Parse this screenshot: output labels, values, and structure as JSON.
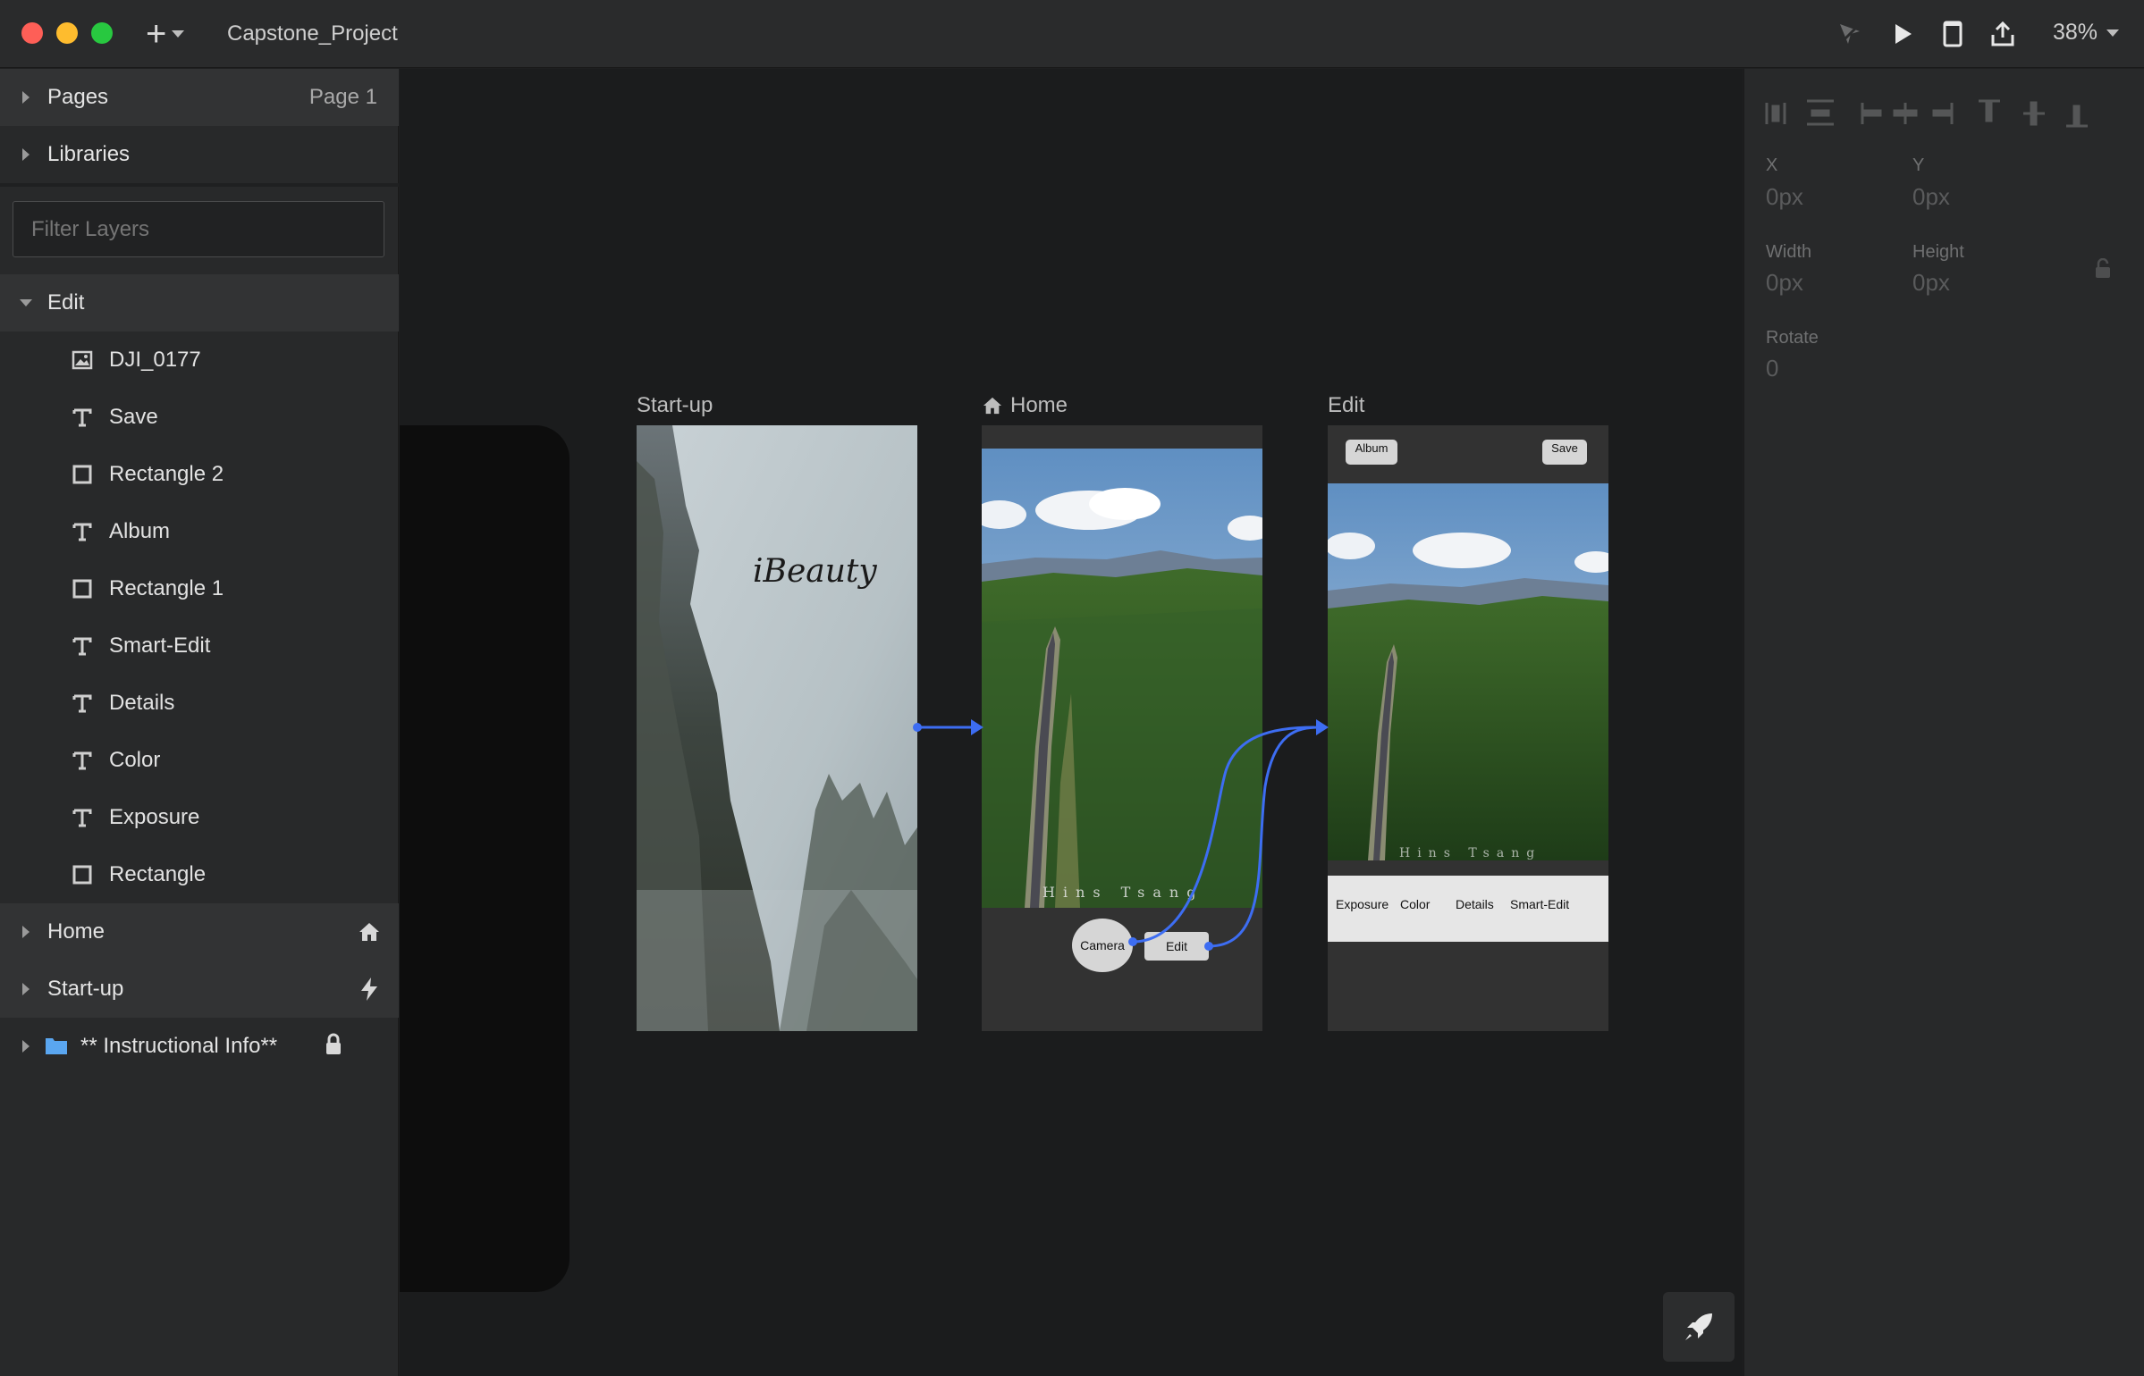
{
  "window": {
    "title": "Capstone_Project",
    "zoom": "38%"
  },
  "left_panel": {
    "pages_label": "Pages",
    "pages_current": "Page 1",
    "libraries_label": "Libraries",
    "filter_placeholder": "Filter Layers",
    "groups": {
      "edit": "Edit",
      "home": "Home",
      "startup": "Start-up",
      "instructional": "** Instructional Info**"
    },
    "edit_layers": [
      {
        "name": "DJI_0177",
        "icon": "image-icon"
      },
      {
        "name": "Save",
        "icon": "text-icon"
      },
      {
        "name": "Rectangle 2",
        "icon": "rectangle-icon"
      },
      {
        "name": "Album",
        "icon": "text-icon"
      },
      {
        "name": "Rectangle 1",
        "icon": "rectangle-icon"
      },
      {
        "name": "Smart-Edit",
        "icon": "text-icon"
      },
      {
        "name": "Details",
        "icon": "text-icon"
      },
      {
        "name": "Color",
        "icon": "text-icon"
      },
      {
        "name": "Exposure",
        "icon": "text-icon"
      },
      {
        "name": "Rectangle",
        "icon": "rectangle-icon"
      }
    ]
  },
  "canvas": {
    "artboards": {
      "startup": {
        "label": "Start-up",
        "brand": "iBeauty"
      },
      "home": {
        "label": "Home",
        "watermark": "Hins Tsang",
        "camera": "Camera",
        "edit": "Edit"
      },
      "edit": {
        "label": "Edit",
        "album": "Album",
        "save": "Save",
        "watermark": "Hins Tsang",
        "tools": [
          "Exposure",
          "Color",
          "Details",
          "Smart-Edit"
        ]
      }
    },
    "link_color": "#3d6df2"
  },
  "inspector": {
    "x_label": "X",
    "x_value": "0px",
    "y_label": "Y",
    "y_value": "0px",
    "width_label": "Width",
    "width_value": "0px",
    "height_label": "Height",
    "height_value": "0px",
    "rotate_label": "Rotate",
    "rotate_value": "0"
  }
}
